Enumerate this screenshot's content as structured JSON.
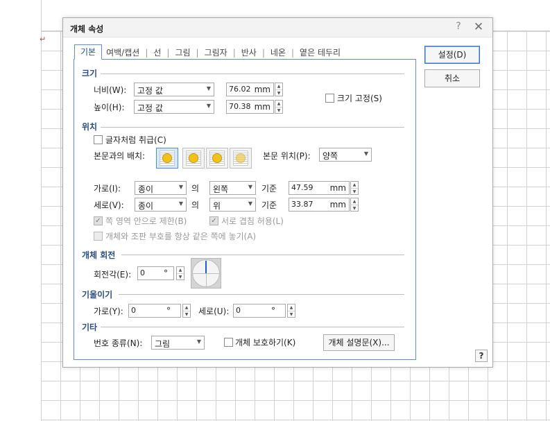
{
  "document": {
    "paragraph_mark": "↵"
  },
  "dialog": {
    "title": "개체 속성",
    "help_glyph": "?",
    "close_glyph": "✕",
    "tabs": [
      {
        "label": "기본",
        "active": true
      },
      {
        "label": "여백/캡션"
      },
      {
        "label": "선"
      },
      {
        "label": "그림"
      },
      {
        "label": "그림자"
      },
      {
        "label": "반사"
      },
      {
        "label": "네온"
      },
      {
        "label": "옅은 테두리"
      }
    ],
    "tab_separator": "|",
    "buttons": {
      "ok": "설정(D)",
      "cancel": "취소",
      "help": "?"
    },
    "size": {
      "heading": "크기",
      "width_label": "너비(W):",
      "width_mode": "고정 값",
      "width_value": "76.02",
      "height_label": "높이(H):",
      "height_mode": "고정 값",
      "height_value": "70.38",
      "unit": "mm",
      "fix_size_label": "크기 고정(S)"
    },
    "position": {
      "heading": "위치",
      "treat_as_char_label": "글자처럼 취급(C)",
      "wrap_label": "본문과의 배치:",
      "wrap_options": [
        "어울림",
        "자리 차지",
        "글 앞으로",
        "글 뒤로"
      ],
      "text_pos_label": "본문 위치(P):",
      "text_pos_value": "양쪽",
      "horiz_label": "가로(I):",
      "horiz_rel": "종이",
      "of_label": "의",
      "horiz_align": "왼쪽",
      "base_label": "기준",
      "horiz_value": "47.59",
      "vert_label": "세로(V):",
      "vert_rel": "종이",
      "vert_align": "위",
      "vert_value": "33.87",
      "unit": "mm",
      "limit_label": "쪽 영역 안으로 제한(B)",
      "overlap_label": "서로 겹침 허용(L)",
      "same_page_label": "개체와 조판 부호를 항상 같은 쪽에 놓기(A)"
    },
    "rotation": {
      "heading": "개체 회전",
      "angle_label": "회전각(E):",
      "angle_value": "0",
      "degree": "°"
    },
    "skew": {
      "heading": "기울이기",
      "horiz_label": "가로(Y):",
      "horiz_value": "0",
      "vert_label": "세로(U):",
      "vert_value": "0",
      "degree": "°"
    },
    "etc": {
      "heading": "기타",
      "numbering_label": "번호 종류(N):",
      "numbering_value": "그림",
      "protect_label": "개체 보호하기(K)",
      "desc_button": "개체 설명문(X)..."
    }
  }
}
